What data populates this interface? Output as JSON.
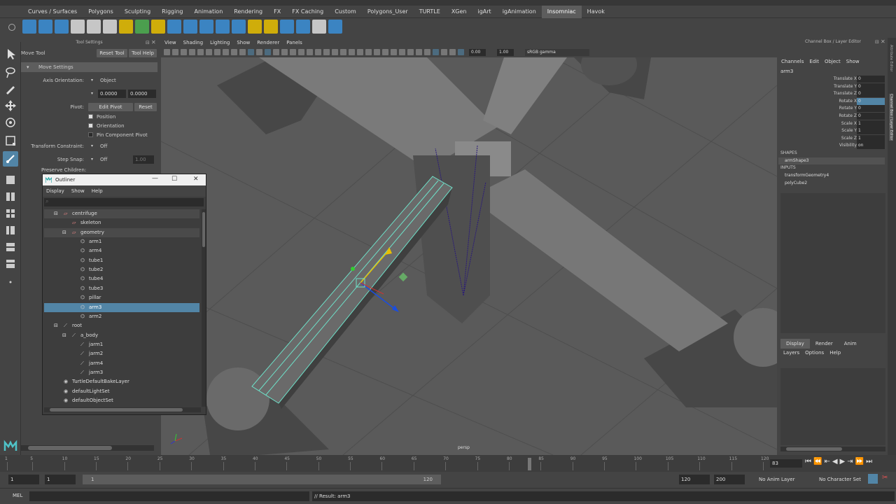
{
  "shelf_tabs": [
    "Curves / Surfaces",
    "Polygons",
    "Sculpting",
    "Rigging",
    "Animation",
    "Rendering",
    "FX",
    "FX Caching",
    "Custom",
    "Polygons_User",
    "TURTLE",
    "XGen",
    "igArt",
    "igAnimation",
    "Insomniac",
    "Havok"
  ],
  "active_shelf": "Insomniac",
  "tool_settings": {
    "panel_title": "Tool Settings",
    "tool_name": "Move Tool",
    "reset_tool": "Reset Tool",
    "tool_help": "Tool Help",
    "section": "Move Settings",
    "axis_orientation_label": "Axis Orientation:",
    "axis_orientation_value": "Object",
    "field1": "0.0000",
    "field2": "0.0000",
    "pivot_label": "Pivot:",
    "edit_pivot": "Edit Pivot",
    "reset": "Reset",
    "position": "Position",
    "orientation": "Orientation",
    "pin_component_pivot": "Pin Component Pivot",
    "transform_constraint_label": "Transform Constraint:",
    "transform_constraint_value": "Off",
    "step_snap_label": "Step Snap:",
    "step_snap_value": "Off",
    "step_snap_num": "1.00",
    "preserve_children": "Preserve Children:"
  },
  "viewport": {
    "menus": [
      "View",
      "Shading",
      "Lighting",
      "Show",
      "Renderer",
      "Panels"
    ],
    "exposure": "0.00",
    "gamma": "1.00",
    "colorspace": "sRGB gamma",
    "camera_label": "persp"
  },
  "channel_box": {
    "panel_title": "Channel Box / Layer Editor",
    "menus": [
      "Channels",
      "Edit",
      "Object",
      "Show"
    ],
    "object": "arm3",
    "attributes": [
      {
        "label": "Translate X",
        "value": "0"
      },
      {
        "label": "Translate Y",
        "value": "0"
      },
      {
        "label": "Translate Z",
        "value": "0"
      },
      {
        "label": "Rotate X",
        "value": "0"
      },
      {
        "label": "Rotate Y",
        "value": "0"
      },
      {
        "label": "Rotate Z",
        "value": "0"
      },
      {
        "label": "Scale X",
        "value": "1"
      },
      {
        "label": "Scale Y",
        "value": "1"
      },
      {
        "label": "Scale Z",
        "value": "1"
      },
      {
        "label": "Visibility",
        "value": "on"
      }
    ],
    "shapes_label": "SHAPES",
    "shape": "armShape3",
    "inputs_label": "INPUTS",
    "inputs": [
      "transformGeometry4",
      "polyCube2"
    ],
    "layer_tabs": [
      "Display",
      "Render",
      "Anim"
    ],
    "layer_menus": [
      "Layers",
      "Options",
      "Help"
    ],
    "side_tabs": [
      "Attribute Editor",
      "Channel Box / Layer Editor"
    ]
  },
  "outliner": {
    "title": "Outliner",
    "menus": [
      "Display",
      "Show",
      "Help"
    ],
    "items": [
      {
        "label": "centrifuge",
        "indent": 1,
        "type": "group",
        "sel": false,
        "expanded": true
      },
      {
        "label": "skeleton",
        "indent": 2,
        "type": "group",
        "sel": false,
        "expanded": false
      },
      {
        "label": "geometry",
        "indent": 2,
        "type": "group",
        "sel": false,
        "expanded": true
      },
      {
        "label": "arm1",
        "indent": 3,
        "type": "mesh",
        "sel": false,
        "expanded": false
      },
      {
        "label": "arm4",
        "indent": 3,
        "type": "mesh",
        "sel": false,
        "expanded": false
      },
      {
        "label": "tube1",
        "indent": 3,
        "type": "mesh",
        "sel": false,
        "expanded": false
      },
      {
        "label": "tube2",
        "indent": 3,
        "type": "mesh",
        "sel": false,
        "expanded": false
      },
      {
        "label": "tube4",
        "indent": 3,
        "type": "mesh",
        "sel": false,
        "expanded": false
      },
      {
        "label": "tube3",
        "indent": 3,
        "type": "mesh",
        "sel": false,
        "expanded": false
      },
      {
        "label": "pillar",
        "indent": 3,
        "type": "mesh",
        "sel": false,
        "expanded": false
      },
      {
        "label": "arm3",
        "indent": 3,
        "type": "mesh",
        "sel": true,
        "expanded": false
      },
      {
        "label": "arm2",
        "indent": 3,
        "type": "mesh",
        "sel": false,
        "expanded": false
      },
      {
        "label": "root",
        "indent": 1,
        "type": "joint",
        "sel": false,
        "expanded": true
      },
      {
        "label": "a_body",
        "indent": 2,
        "type": "joint",
        "sel": false,
        "expanded": true
      },
      {
        "label": "jarm1",
        "indent": 3,
        "type": "joint",
        "sel": false,
        "expanded": false
      },
      {
        "label": "jarm2",
        "indent": 3,
        "type": "joint",
        "sel": false,
        "expanded": false
      },
      {
        "label": "jarm4",
        "indent": 3,
        "type": "joint",
        "sel": false,
        "expanded": false
      },
      {
        "label": "jarm3",
        "indent": 3,
        "type": "joint",
        "sel": false,
        "expanded": false
      },
      {
        "label": "TurtleDefaultBakeLayer",
        "indent": 1,
        "type": "set",
        "sel": false,
        "expanded": false
      },
      {
        "label": "defaultLightSet",
        "indent": 1,
        "type": "set",
        "sel": false,
        "expanded": false
      },
      {
        "label": "defaultObjectSet",
        "indent": 1,
        "type": "set",
        "sel": false,
        "expanded": false
      }
    ]
  },
  "timeline": {
    "ticks": [
      "1",
      "5",
      "10",
      "15",
      "20",
      "25",
      "30",
      "35",
      "40",
      "45",
      "50",
      "55",
      "60",
      "65",
      "70",
      "75",
      "80",
      "85",
      "90",
      "95",
      "100",
      "105",
      "110",
      "115",
      "120"
    ],
    "current_frame": "83"
  },
  "range": {
    "start": "1",
    "start2": "1",
    "slider_start": "1",
    "slider_end": "120",
    "end": "120",
    "end2": "200",
    "anim_layer": "No Anim Layer",
    "char_set": "No Character Set"
  },
  "cmd": {
    "lang": "MEL",
    "result": "// Result: arm3"
  },
  "colors": {
    "selection": "#5285a6",
    "wireframe": "#6ee0c8"
  }
}
